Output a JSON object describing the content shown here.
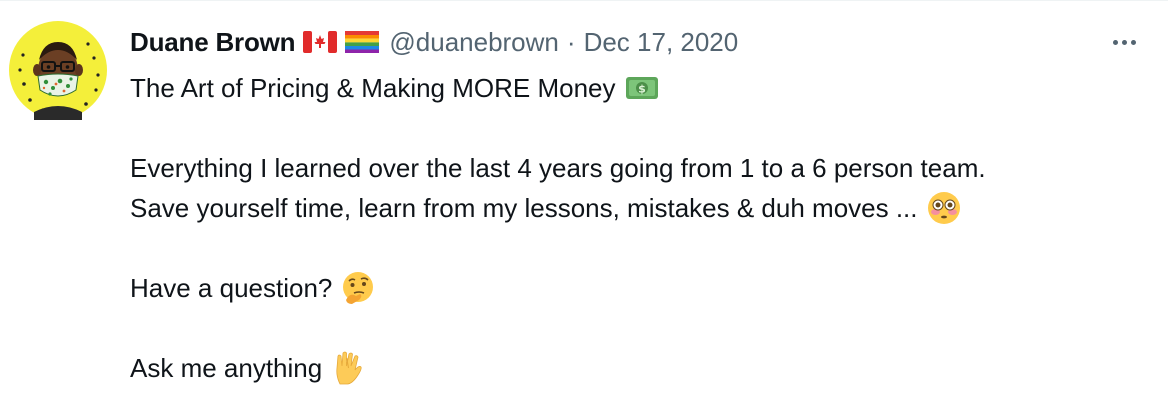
{
  "tweet": {
    "display_name": "Duane Brown",
    "handle": "@duanebrown",
    "separator": "·",
    "date": "Dec 17, 2020",
    "more_icon": "more-horizontal-icon",
    "flags": [
      "canada-flag-icon",
      "rainbow-flag-icon"
    ],
    "lines": {
      "title": "The Art of Pricing & Making MORE Money",
      "body1": "Everything I learned over the last 4 years going from 1 to a 6 person team.",
      "body2": "Save yourself time, learn from my lessons, mistakes & duh moves ...",
      "question": "Have a question?",
      "ask": "Ask me anything"
    },
    "emojis": {
      "money": "dollar-banknote-emoji",
      "flushed": "flushed-face-emoji",
      "thinking": "thinking-face-emoji",
      "vulcan": "vulcan-salute-emoji"
    }
  },
  "colors": {
    "text_primary": "#0f1419",
    "text_secondary": "#536471",
    "avatar_background": "#f4ef3a"
  }
}
